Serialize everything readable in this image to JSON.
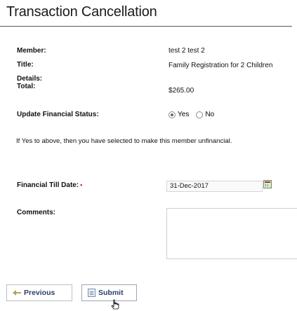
{
  "page": {
    "title": "Transaction Cancellation"
  },
  "details": {
    "member_label": "Member:",
    "member_value": "test 2 test 2",
    "title_label": "Title:",
    "title_value": "Family Registration for 2 Children",
    "details_label": "Details:",
    "total_label": "Total:",
    "total_value": "$265.00"
  },
  "financial_status": {
    "label": "Update Financial Status:",
    "options": [
      {
        "label": "Yes",
        "checked": true
      },
      {
        "label": "No",
        "checked": false
      }
    ],
    "note": "If Yes to above, then you have selected to make this member unfinancial."
  },
  "till_date": {
    "label": "Financial Till Date:",
    "required_marker": "•",
    "value": "31-Dec-2017",
    "icon": "calendar-icon"
  },
  "comments": {
    "label": "Comments:",
    "value": ""
  },
  "buttons": {
    "previous_label": "Previous",
    "previous_icon": "back-arrow-icon",
    "submit_label": "Submit",
    "submit_icon": "document-icon"
  }
}
